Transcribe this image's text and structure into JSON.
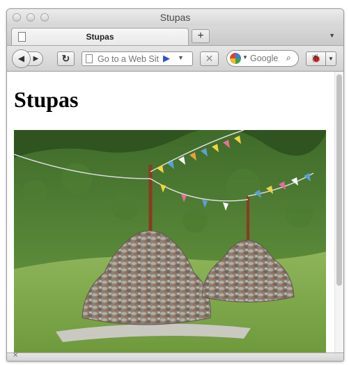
{
  "window": {
    "title": "Stupas"
  },
  "tabs": [
    {
      "label": "Stupas"
    }
  ],
  "tabbar": {
    "new_tab_label": "+",
    "menu_icon": "chevron-down-icon"
  },
  "navbar": {
    "back_icon": "back-arrow-icon",
    "forward_icon": "forward-arrow-icon",
    "reload_icon": "reload-icon",
    "url_placeholder": "Go to a Web Sit",
    "go_icon": "go-arrow-icon",
    "stop_icon": "stop-x-icon",
    "search_engine_icon": "google-icon",
    "search_placeholder": "Google",
    "extension_icon": "firebug-icon"
  },
  "page": {
    "heading": "Stupas",
    "image_alt": "Two stone stupas with prayer flags on a grassy hillside"
  },
  "statusbar": {
    "close_icon": "close-x-icon"
  },
  "colors": {
    "chrome": "#d6d6d6",
    "go_arrow": "#2a56c6",
    "heading": "#000000"
  }
}
